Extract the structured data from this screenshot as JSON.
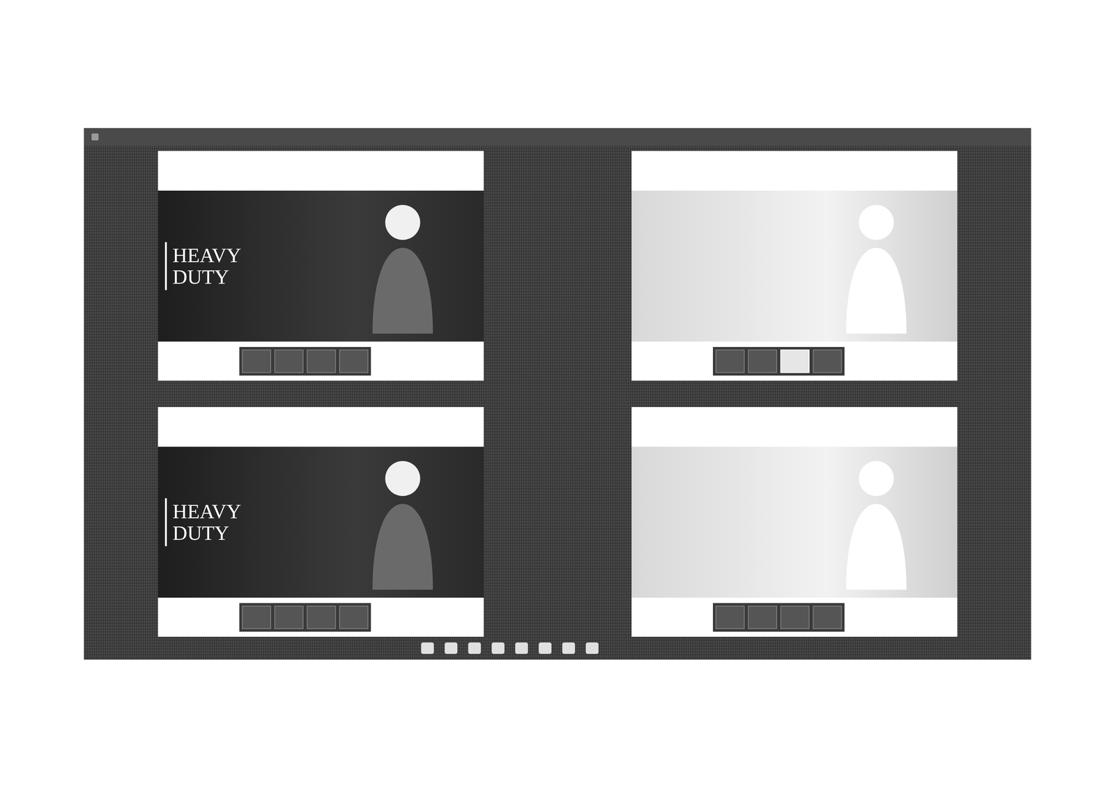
{
  "windows": [
    {
      "hero_title": "HEAVY DUTY",
      "theme": "dark",
      "thumbnails": [
        {
          "selected": false
        },
        {
          "selected": false
        },
        {
          "selected": false
        },
        {
          "selected": false
        }
      ]
    },
    {
      "hero_title": "",
      "theme": "light",
      "thumbnails": [
        {
          "selected": false
        },
        {
          "selected": false
        },
        {
          "selected": true
        },
        {
          "selected": false
        }
      ]
    },
    {
      "hero_title": "HEAVY DUTY",
      "theme": "dark",
      "thumbnails": [
        {
          "selected": false
        },
        {
          "selected": false
        },
        {
          "selected": false
        },
        {
          "selected": false
        }
      ]
    },
    {
      "hero_title": "",
      "theme": "light",
      "thumbnails": [
        {
          "selected": false
        },
        {
          "selected": false
        },
        {
          "selected": false
        },
        {
          "selected": false
        }
      ]
    }
  ]
}
